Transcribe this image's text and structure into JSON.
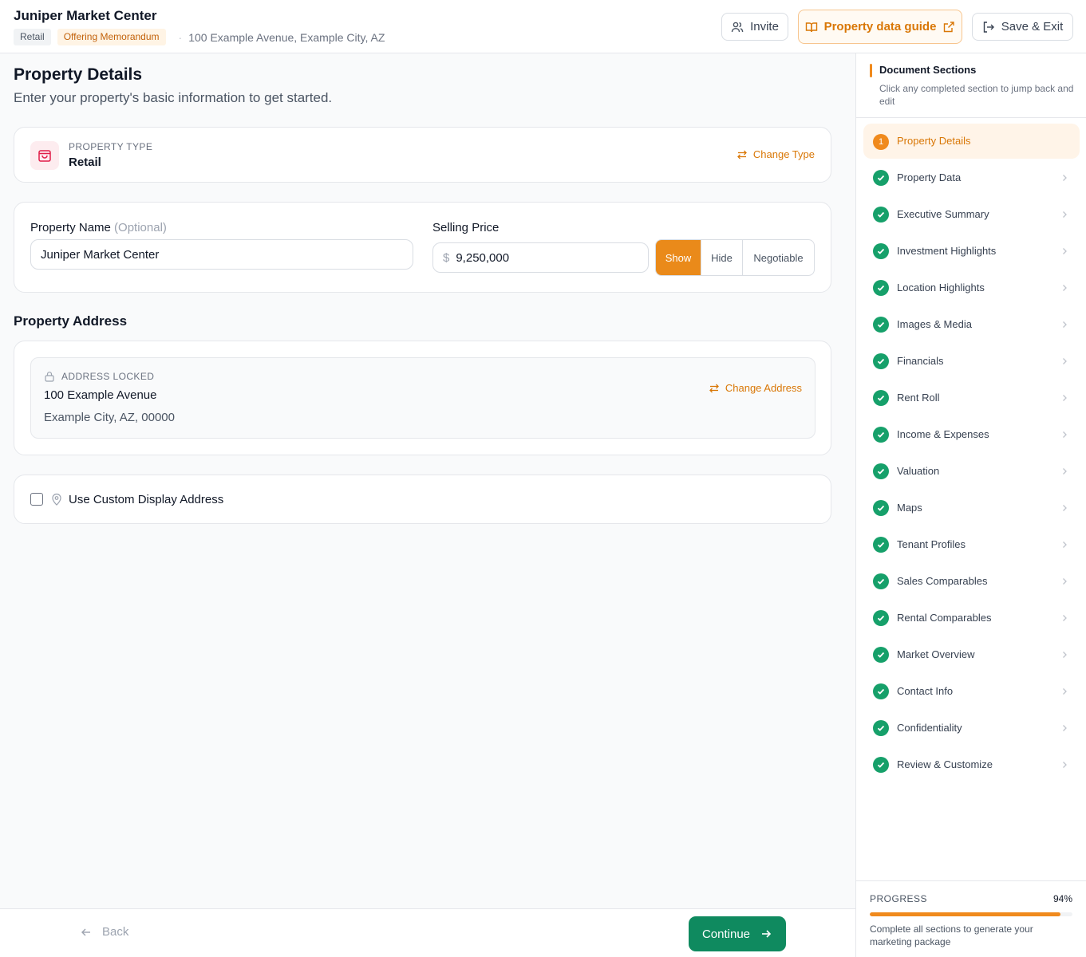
{
  "header": {
    "title": "Juniper Market Center",
    "tag_type": "Retail",
    "tag_doc": "Offering Memorandum",
    "address": "100 Example Avenue, Example City, AZ",
    "invite_label": "Invite",
    "guide_label": "Property data guide",
    "save_label": "Save & Exit"
  },
  "main": {
    "title": "Property Details",
    "subtitle": "Enter your property's basic information to get started.",
    "property_type": {
      "label": "PROPERTY TYPE",
      "value": "Retail",
      "change_label": "Change Type"
    },
    "name_field": {
      "label": "Property Name",
      "optional": "(Optional)",
      "value": "Juniper Market Center"
    },
    "price_field": {
      "label": "Selling Price",
      "currency": "$",
      "value": "9,250,000",
      "options": [
        "Show",
        "Hide",
        "Negotiable"
      ],
      "selected": "Show"
    },
    "address_section_title": "Property Address",
    "address": {
      "locked_label": "ADDRESS LOCKED",
      "line1": "100 Example Avenue",
      "line2": "Example City, AZ, 00000",
      "change_label": "Change Address"
    },
    "custom_address_label": "Use Custom Display Address"
  },
  "footer": {
    "back_label": "Back",
    "continue_label": "Continue"
  },
  "sidebar": {
    "title": "Document Sections",
    "subtitle": "Click any completed section to jump back and edit",
    "items": [
      {
        "label": "Property Details",
        "status": "active",
        "number": "1"
      },
      {
        "label": "Property Data",
        "status": "complete"
      },
      {
        "label": "Executive Summary",
        "status": "complete"
      },
      {
        "label": "Investment Highlights",
        "status": "complete"
      },
      {
        "label": "Location Highlights",
        "status": "complete"
      },
      {
        "label": "Images & Media",
        "status": "complete"
      },
      {
        "label": "Financials",
        "status": "complete"
      },
      {
        "label": "Rent Roll",
        "status": "complete"
      },
      {
        "label": "Income & Expenses",
        "status": "complete"
      },
      {
        "label": "Valuation",
        "status": "complete"
      },
      {
        "label": "Maps",
        "status": "complete"
      },
      {
        "label": "Tenant Profiles",
        "status": "complete"
      },
      {
        "label": "Sales Comparables",
        "status": "complete"
      },
      {
        "label": "Rental Comparables",
        "status": "complete"
      },
      {
        "label": "Market Overview",
        "status": "complete"
      },
      {
        "label": "Contact Info",
        "status": "complete"
      },
      {
        "label": "Confidentiality",
        "status": "complete"
      },
      {
        "label": "Review & Customize",
        "status": "complete"
      }
    ],
    "progress": {
      "label": "PROGRESS",
      "value_text": "94%",
      "value": 0.94,
      "note": "Complete all sections to generate your marketing package"
    }
  },
  "colors": {
    "accent": "#f08a1d",
    "success": "#16a06a",
    "primary_button": "#0f8a5f"
  }
}
